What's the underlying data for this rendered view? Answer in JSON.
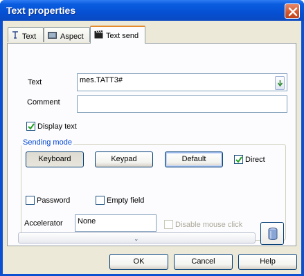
{
  "window": {
    "title": "Text properties",
    "close_icon": "close-icon"
  },
  "tabs": [
    {
      "label": "Text",
      "icon": "text-tool-icon"
    },
    {
      "label": "Aspect",
      "icon": "aspect-image-icon"
    },
    {
      "label": "Text send",
      "icon": "clapperboard-icon",
      "active": true
    }
  ],
  "fields": {
    "text_label": "Text",
    "text_value": "mes.TATT3#",
    "comment_label": "Comment",
    "comment_value": "",
    "display_text_label": "Display text",
    "display_text_checked": true
  },
  "sending_mode": {
    "title": "Sending mode",
    "keyboard_label": "Keyboard",
    "keypad_label": "Keypad",
    "default_label": "Default",
    "direct_label": "Direct",
    "direct_checked": true,
    "password_label": "Password",
    "password_checked": false,
    "empty_field_label": "Empty field",
    "empty_field_checked": false,
    "accelerator_label": "Accelerator",
    "accelerator_value": "None",
    "disable_mouse_label": "Disable mouse click",
    "disable_mouse_checked": false
  },
  "footer": {
    "ok_label": "OK",
    "cancel_label": "Cancel",
    "help_label": "Help"
  },
  "colors": {
    "titlebar": "#0650d4",
    "dialog_bg": "#ece9d8",
    "group_title": "#0046d5",
    "active_tab_accent": "#e68b2c"
  }
}
